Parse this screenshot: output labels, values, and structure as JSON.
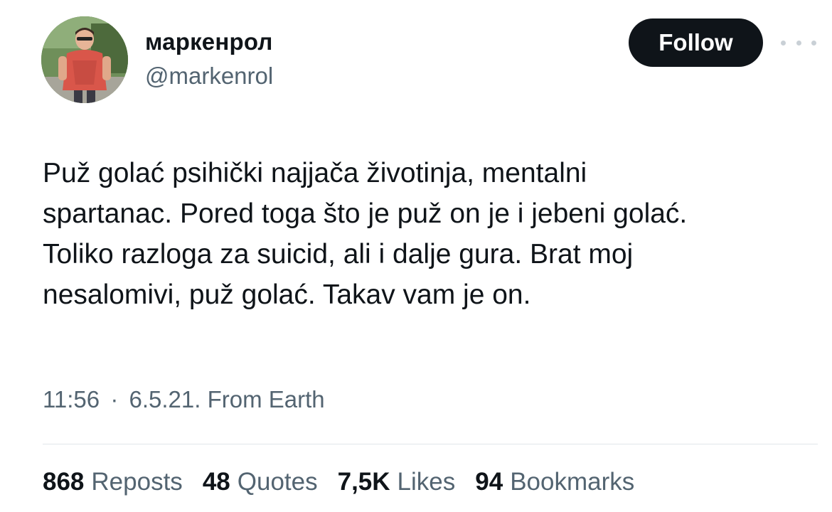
{
  "author": {
    "display_name": "маркенрол",
    "handle": "@markenrol",
    "avatar_icon": "profile-photo"
  },
  "follow_button": {
    "label": "Follow"
  },
  "more_menu": {
    "icon": "more-horizontal-icon"
  },
  "tweet": {
    "lines": [
      "Puž golać psihički najjača životinja, mentalni",
      "spartanac. Pored toga što je puž on je i jebeni golać.",
      "Toliko razloga za suicid, ali i dalje gura. Brat moj",
      "nesalomivi, puž golać. Takav vam je on."
    ]
  },
  "meta": {
    "time": "11:56",
    "separator": "·",
    "date": "6.5.21.",
    "source": "From Earth"
  },
  "stats": [
    {
      "count": "868",
      "label": "Reposts"
    },
    {
      "count": "48",
      "label": "Quotes"
    },
    {
      "count": "7,5K",
      "label": "Likes"
    },
    {
      "count": "94",
      "label": "Bookmarks"
    }
  ],
  "colors": {
    "text_primary": "#0f1419",
    "text_secondary": "#536471",
    "button_bg": "#0f1419",
    "divider": "#e1e6ea"
  }
}
